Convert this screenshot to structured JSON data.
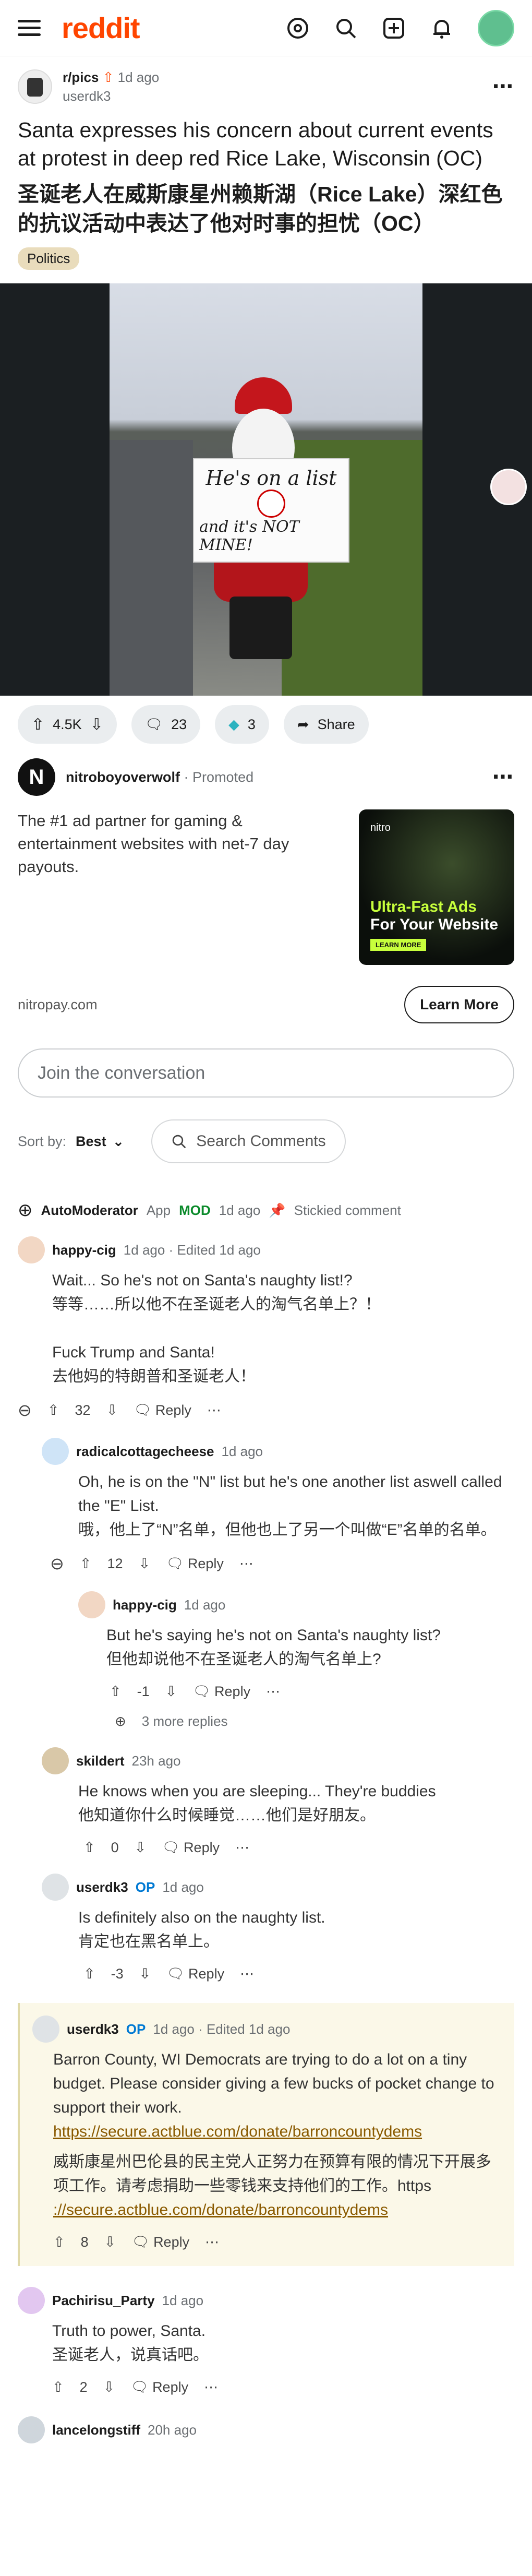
{
  "header": {
    "logo": "reddit"
  },
  "post": {
    "subreddit": "r/pics",
    "age": "1d ago",
    "author": "userdk3",
    "title_en": "Santa expresses his concern about current events at protest in deep red Rice Lake, Wisconsin (OC)",
    "title_zh": "圣诞老人在威斯康星州赖斯湖（Rice Lake）深红色的抗议活动中表达了他对时事的担忧（OC）",
    "flair": "Politics",
    "sign_line1": "He's on a list",
    "sign_line2": "and it's NOT MINE!",
    "upvotes": "4.5K",
    "comments": "23",
    "awards": "3",
    "share": "Share"
  },
  "ad": {
    "advertiser": "nitroboyoverwolf",
    "promoted": "Promoted",
    "text": "The #1 ad partner for gaming & entertainment websites with net-7 day payouts.",
    "img_tag": "nitro",
    "img_line1": "Ultra-Fast Ads",
    "img_line2": "For Your Website",
    "img_btn": "LEARN MORE",
    "url": "nitropay.com",
    "cta": "Learn More"
  },
  "join_placeholder": "Join the conversation",
  "sort": {
    "label": "Sort by:",
    "value": "Best",
    "search": "Search Comments"
  },
  "automod": {
    "name": "AutoModerator",
    "app": "App",
    "mod": "MOD",
    "age": "1d ago",
    "stickied": "Stickied comment"
  },
  "comments": [
    {
      "user": "happy-cig",
      "meta": "1d ago · Edited 1d ago",
      "lines": [
        "Wait... So he's not on Santa's naughty list!?",
        "等等……所以他不在圣诞老人的淘气名单上？！",
        "",
        "Fuck Trump and Santa!",
        "去他妈的特朗普和圣诞老人！"
      ],
      "score": "32",
      "reply": "Reply"
    },
    {
      "user": "radicalcottagecheese",
      "meta": "1d ago",
      "lines": [
        "Oh, he is on the \"N\" list but he's one another list aswell called the \"E\" List.",
        "哦，他上了“N”名单，但他也上了另一个叫做“E”名单的名单。"
      ],
      "score": "12",
      "reply": "Reply"
    },
    {
      "user": "happy-cig",
      "meta": "1d ago",
      "lines": [
        "But he's saying he's not on Santa's naughty list?",
        "但他却说他不在圣诞老人的淘气名单上?"
      ],
      "score": "-1",
      "reply": "Reply"
    },
    {
      "more": "3 more replies"
    },
    {
      "user": "skildert",
      "meta": "23h ago",
      "lines": [
        "He knows when you are sleeping... They're buddies",
        "他知道你什么时候睡觉……他们是好朋友。"
      ],
      "score": "0",
      "reply": "Reply"
    },
    {
      "user": "userdk3",
      "op": "OP",
      "meta": "1d ago",
      "lines": [
        "Is definitely also on the naughty list.",
        "肯定也在黑名单上。"
      ],
      "score": "-3",
      "reply": "Reply"
    },
    {
      "user": "userdk3",
      "op": "OP",
      "meta": "1d ago · Edited 1d ago",
      "lines": [
        "Barron County, WI Democrats are trying to do a lot on a tiny budget. Please consider giving a few bucks of pocket change to support their work."
      ],
      "link": "https://secure.actblue.com/donate/barroncountydems",
      "lines2": [
        "威斯康星州巴伦县的民主党人正努力在预算有限的情况下开展多项工作。请考虑捐助一些零钱来支持他们的工作。https"
      ],
      "link2": "://secure.actblue.com/donate/barroncountydems",
      "score": "8",
      "reply": "Reply"
    },
    {
      "user": "Pachirisu_Party",
      "meta": "1d ago",
      "lines": [
        "Truth to power, Santa.",
        "圣诞老人，说真话吧。"
      ],
      "score": "2",
      "reply": "Reply"
    },
    {
      "user": "lancelongstiff",
      "meta": "20h ago"
    }
  ]
}
